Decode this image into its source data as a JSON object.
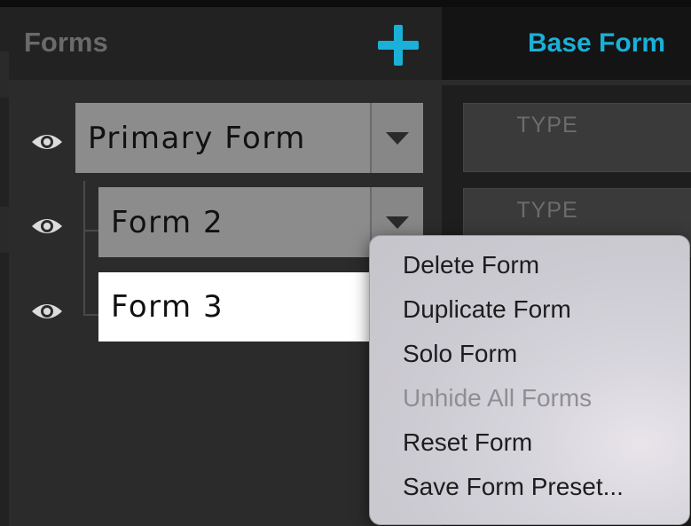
{
  "forms_panel": {
    "title": "Forms",
    "add_icon": "plus-icon",
    "accent_color": "#1ab0d8"
  },
  "right_panel": {
    "title": "Base Form",
    "fields": [
      {
        "label": "TYPE"
      },
      {
        "label": "TYPE"
      }
    ]
  },
  "forms": [
    {
      "name": "Primary Form",
      "visible_icon": "eye-icon",
      "style": "gray",
      "has_dropdown": true
    },
    {
      "name": "Form 2",
      "visible_icon": "eye-icon",
      "style": "gray",
      "has_dropdown": true
    },
    {
      "name": "Form 3",
      "visible_icon": "eye-icon",
      "style": "white",
      "has_dropdown": false
    }
  ],
  "context_menu": {
    "items": [
      {
        "label": "Delete Form",
        "enabled": true
      },
      {
        "label": "Duplicate Form",
        "enabled": true
      },
      {
        "label": "Solo Form",
        "enabled": true
      },
      {
        "label": "Unhide All Forms",
        "enabled": false
      },
      {
        "label": "Reset Form",
        "enabled": true
      },
      {
        "label": "Save Form Preset...",
        "enabled": true
      }
    ]
  }
}
